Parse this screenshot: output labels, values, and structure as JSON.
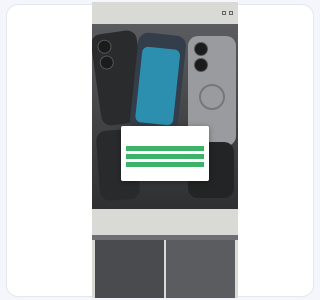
{
  "store": {
    "brand": "",
    "menu_label": ""
  },
  "section": {
    "title": "",
    "subtitle": ""
  },
  "cookie_dialog": {
    "logo": "",
    "heading": "",
    "body": "",
    "buttons": [
      "",
      "",
      ""
    ]
  },
  "colors": {
    "accept_green": "#3fb26a",
    "hero_bg": "#3f4042",
    "page_bg": "#f4f6fb"
  },
  "icons": [
    "menu-icon",
    "search-icon",
    "cart-icon"
  ]
}
